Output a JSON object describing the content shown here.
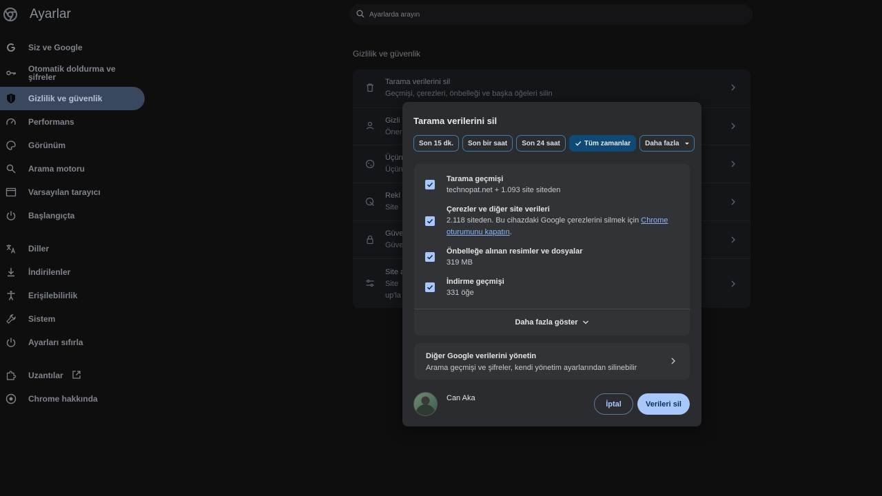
{
  "app": {
    "title": "Ayarlar"
  },
  "search": {
    "placeholder": "Ayarlarda arayın"
  },
  "sidebar": {
    "items": [
      {
        "label": "Siz ve Google",
        "icon": "google-g-icon",
        "active": false
      },
      {
        "label": "Otomatik doldurma ve şifreler",
        "icon": "key-icon",
        "active": false
      },
      {
        "label": "Gizlilik ve güvenlik",
        "icon": "shield-icon",
        "active": true
      },
      {
        "label": "Performans",
        "icon": "speedometer-icon",
        "active": false
      },
      {
        "label": "Görünüm",
        "icon": "palette-icon",
        "active": false
      },
      {
        "label": "Arama motoru",
        "icon": "search-icon",
        "active": false
      },
      {
        "label": "Varsayılan tarayıcı",
        "icon": "browser-icon",
        "active": false
      },
      {
        "label": "Başlangıçta",
        "icon": "power-icon",
        "active": false
      },
      {
        "label": "Diller",
        "icon": "translate-icon",
        "active": false
      },
      {
        "label": "İndirilenler",
        "icon": "download-icon",
        "active": false
      },
      {
        "label": "Erişilebilirlik",
        "icon": "accessibility-icon",
        "active": false
      },
      {
        "label": "Sistem",
        "icon": "wrench-icon",
        "active": false
      },
      {
        "label": "Ayarları sıfırla",
        "icon": "reset-icon",
        "active": false
      },
      {
        "label": "Uzantılar",
        "icon": "puzzle-icon",
        "active": false
      },
      {
        "label": "Chrome hakkında",
        "icon": "chrome-icon",
        "active": false
      }
    ]
  },
  "main": {
    "section_title": "Gizlilik ve güvenlik",
    "rows": [
      {
        "title": "Tarama verilerini sil",
        "subtitle": "Geçmişi, çerezleri, önbelleği ve başka öğeleri silin",
        "icon": "trash-icon"
      },
      {
        "title": "Gizli",
        "subtitle": "Öner",
        "icon": "privacy-guide-icon"
      },
      {
        "title": "Üçün",
        "subtitle": "Üçün",
        "icon": "cookie-icon"
      },
      {
        "title": "Rekl",
        "subtitle": "Site",
        "icon": "ads-icon"
      },
      {
        "title": "Güve",
        "subtitle": "Güve",
        "icon": "lock-icon"
      },
      {
        "title": "Site a",
        "subtitle": "Site",
        "subtitle2": "up'la",
        "icon": "tune-icon"
      }
    ]
  },
  "dialog": {
    "title": "Tarama verilerini sil",
    "time_ranges": [
      "Son 15 dk.",
      "Son bir saat",
      "Son 24 saat",
      "Tüm zamanlar",
      "Daha fazla"
    ],
    "selected_range": "Tüm zamanlar",
    "options": [
      {
        "title": "Tarama geçmişi",
        "desc": "technopat.net + 1.093 site siteden",
        "checked": true
      },
      {
        "title": "Çerezler ve diğer site verileri",
        "desc": "2.118 siteden. Bu cihazdaki Google çerezlerini silmek için",
        "link": "Chrome oturumunu kapatın",
        "desc_end": ".",
        "checked": true
      },
      {
        "title": "Önbelleğe alınan resimler ve dosyalar",
        "desc": "319 MB",
        "checked": true
      },
      {
        "title": "İndirme geçmişi",
        "desc": "331 öğe",
        "checked": true
      }
    ],
    "show_more": "Daha fazla göster",
    "google_data": {
      "title": "Diğer Google verilerini yönetin",
      "subtitle": "Arama geçmişi ve şifreler, kendi yönetim ayarlarından silinebilir"
    },
    "user_name": "Can Aka",
    "cancel_label": "İptal",
    "delete_label": "Verileri sil"
  },
  "colors": {
    "accent": "#a8c7fa",
    "active_nav": "#39485e",
    "selected_chip": "#0e4a75",
    "dialog_bg": "#2b2c2f"
  }
}
